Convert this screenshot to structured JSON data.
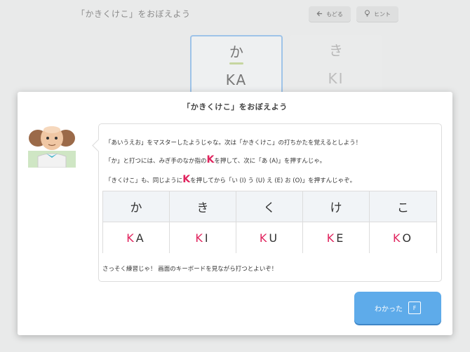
{
  "background": {
    "title": "「かきくけこ」をおぼえよう",
    "back_label": "もどる",
    "hint_label": "ヒント",
    "cards": [
      {
        "kana": "か",
        "romaji": "KA"
      },
      {
        "kana": "き",
        "romaji": "KI"
      }
    ]
  },
  "dialog": {
    "title": "「かきくけこ」をおぼえよう",
    "line1": "「あいうえお」をマスターしたようじゃな。次は「かきくけこ」の打ちかたを覚えるとしよう！",
    "line2a": "「か」と打つには、みぎ手のなか指の",
    "line2k": "K",
    "line2b": "を押して、次に「あ (A)」を押すんじゃ。",
    "line3a": "「きくけこ」も、同じように",
    "line3k": "K",
    "line3b": "を押してから「い (I) う (U) え (E) お (O)」を押すんじゃぞ。",
    "line4": "さっそく練習じゃ！ 画面のキーボードを見ながら打つとよいぞ！",
    "table": [
      {
        "kana": "か",
        "consonant": "K",
        "vowel": "A"
      },
      {
        "kana": "き",
        "consonant": "K",
        "vowel": "I"
      },
      {
        "kana": "く",
        "consonant": "K",
        "vowel": "U"
      },
      {
        "kana": "け",
        "consonant": "K",
        "vowel": "E"
      },
      {
        "kana": "こ",
        "consonant": "K",
        "vowel": "O"
      }
    ],
    "ok_label": "わかった",
    "ok_key": "F",
    "accent_color": "#e0245e",
    "button_color": "#5eabea"
  }
}
